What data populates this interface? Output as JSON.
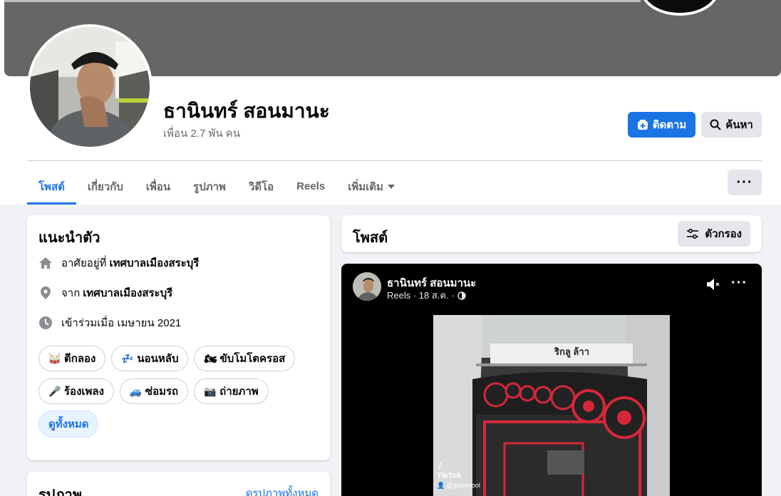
{
  "profile": {
    "name": "ธานินทร์ สอนมานะ",
    "friends": "เพื่อน 2.7 พัน คน",
    "follow_label": "ติดตาม",
    "search_label": "ค้นหา"
  },
  "tabs": [
    {
      "label": "โพสต์",
      "active": true
    },
    {
      "label": "เกี่ยวกับ"
    },
    {
      "label": "เพื่อน"
    },
    {
      "label": "รูปภาพ"
    },
    {
      "label": "วิดีโอ"
    },
    {
      "label": "Reels"
    },
    {
      "label": "เพิ่มเติม"
    }
  ],
  "intro": {
    "title": "แนะนำตัว",
    "lives_prefix": "อาศัยอยู่ที่",
    "lives_place": "เทศบาลเมืองสระบุรี",
    "from_prefix": "จาก",
    "from_place": "เทศบาลเมืองสระบุรี",
    "joined": "เข้าร่วมเมื่อ เมษายน 2021",
    "hobbies": [
      {
        "emoji": "🥁",
        "label": "ตีกลอง"
      },
      {
        "emoji": "💤",
        "label": "นอนหลับ"
      },
      {
        "emoji": "🏍",
        "label": "ขับโมโตครอส"
      },
      {
        "emoji": "🎤",
        "label": "ร้องเพลง"
      },
      {
        "emoji": "🚙",
        "label": "ซ่อมรถ"
      },
      {
        "emoji": "📷",
        "label": "ถ่ายภาพ"
      }
    ],
    "see_all": "ดูทั้งหมด"
  },
  "photos": {
    "title": "รูปภาพ",
    "see_all": "ดูรูปภาพทั้งหมด"
  },
  "posts": {
    "title": "โพสต์",
    "filter_label": "ตัวกรอง"
  },
  "reel": {
    "author": "ธานินทร์ สอนมานะ",
    "meta": "Reels · 18 ส.ค. ·",
    "watermark_brand": "TikTok",
    "watermark_user": "@glovepool"
  },
  "colors": {
    "accent": "#1b74e4",
    "speaker_red": "#d6273a"
  }
}
